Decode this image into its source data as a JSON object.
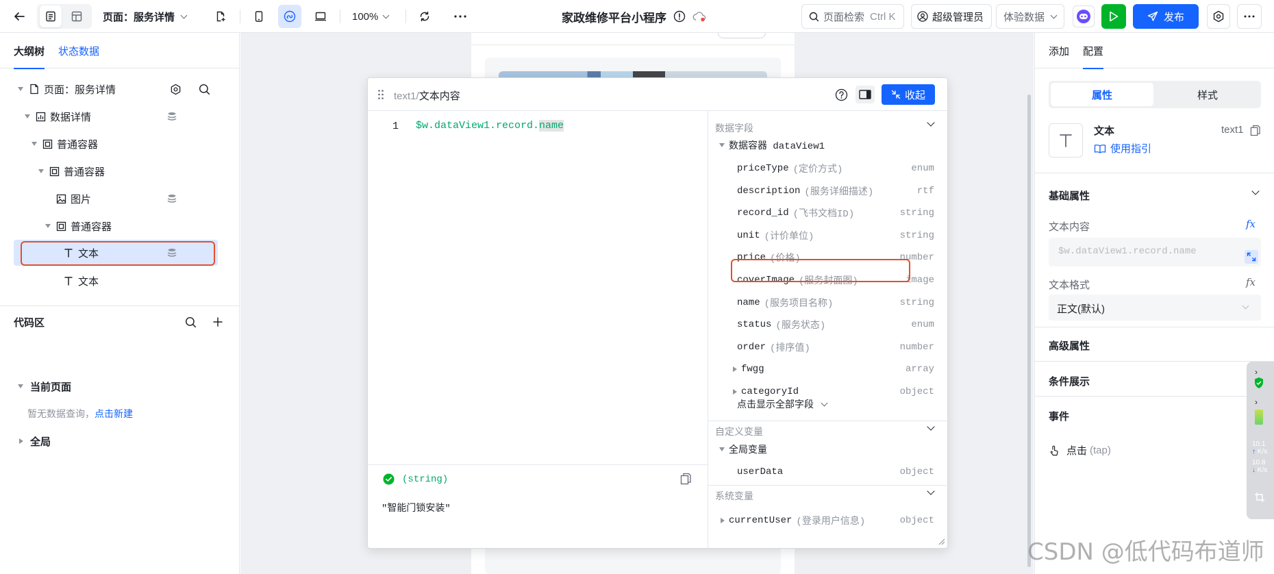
{
  "topbar": {
    "page_label": "页面：服务详情",
    "zoom": "100%",
    "app_title": "家政维修平台小程序",
    "search_placeholder": "页面检索",
    "search_shortcut": "Ctrl K",
    "user_role": "超级管理员",
    "env": "体验数据",
    "publish": "发布"
  },
  "left": {
    "tabs": [
      "大纲树",
      "状态数据"
    ],
    "tree": [
      {
        "label": "页面：服务详情"
      },
      {
        "label": "数据详情"
      },
      {
        "label": "普通容器"
      },
      {
        "label": "普通容器"
      },
      {
        "label": "图片"
      },
      {
        "label": "普通容器"
      },
      {
        "label": "文本"
      },
      {
        "label": "文本"
      }
    ],
    "code_area": {
      "title": "代码区",
      "current_page": "当前页面",
      "empty_text": "暂无数据查询，",
      "create_link": "点击新建",
      "global": "全局"
    }
  },
  "popup": {
    "breadcrumb_id": "text1",
    "breadcrumb_sep": "/",
    "breadcrumb_title": "文本内容",
    "collapse_label": "收起",
    "line_number": "1",
    "code_prefix": "$w.dataView1.record.",
    "code_highlight": "name",
    "result_type": "(string)",
    "result_value": "\"智能门锁安装\"",
    "data_fields_title": "数据字段",
    "container_label": "数据容器 dataView1",
    "fields": [
      {
        "name": "priceType",
        "desc": "(定价方式)",
        "type": "enum"
      },
      {
        "name": "description",
        "desc": "(服务详细描述)",
        "type": "rtf"
      },
      {
        "name": "record_id",
        "desc": "(飞书文档ID)",
        "type": "string"
      },
      {
        "name": "unit",
        "desc": "(计价单位)",
        "type": "string"
      },
      {
        "name": "price",
        "desc": "(价格)",
        "type": "number"
      },
      {
        "name": "coverImage",
        "desc": "(服务封面图)",
        "type": "image"
      },
      {
        "name": "name",
        "desc": "(服务项目名称)",
        "type": "string"
      },
      {
        "name": "status",
        "desc": "(服务状态)",
        "type": "enum"
      },
      {
        "name": "order",
        "desc": "(排序值)",
        "type": "number"
      },
      {
        "name": "fwgg",
        "desc": "",
        "type": "array"
      },
      {
        "name": "categoryId",
        "desc": "",
        "type": "object"
      }
    ],
    "show_all": "点击显示全部字段",
    "custom_vars_title": "自定义变量",
    "global_vars_label": "全局变量",
    "global_var": {
      "name": "userData",
      "type": "object"
    },
    "system_vars_title": "系统变量",
    "system_var": {
      "name": "currentUser",
      "desc": "(登录用户信息)",
      "type": "object"
    }
  },
  "right": {
    "tabs": [
      "添加",
      "配置"
    ],
    "segments": [
      "属性",
      "样式"
    ],
    "component_name": "文本",
    "component_id": "text1",
    "guide_link": "使用指引",
    "basic_props": "基础属性",
    "text_content_label": "文本内容",
    "text_content_value": "$w.dataView1.record.name",
    "text_format_label": "文本格式",
    "text_format_value": "正文(默认)",
    "advanced_props": "高级属性",
    "conditional": "条件展示",
    "events": "事件",
    "event_item": "点击",
    "event_item_en": "(tap)",
    "fx": "fx"
  },
  "widget": {
    "up": "10.1",
    "down": "10.8",
    "unit": "K/s"
  },
  "watermark": "CSDN @低代码布道师",
  "colors": {
    "primary": "#1664ff",
    "highlight_border": "#e0502d",
    "green": "#00b42a"
  }
}
